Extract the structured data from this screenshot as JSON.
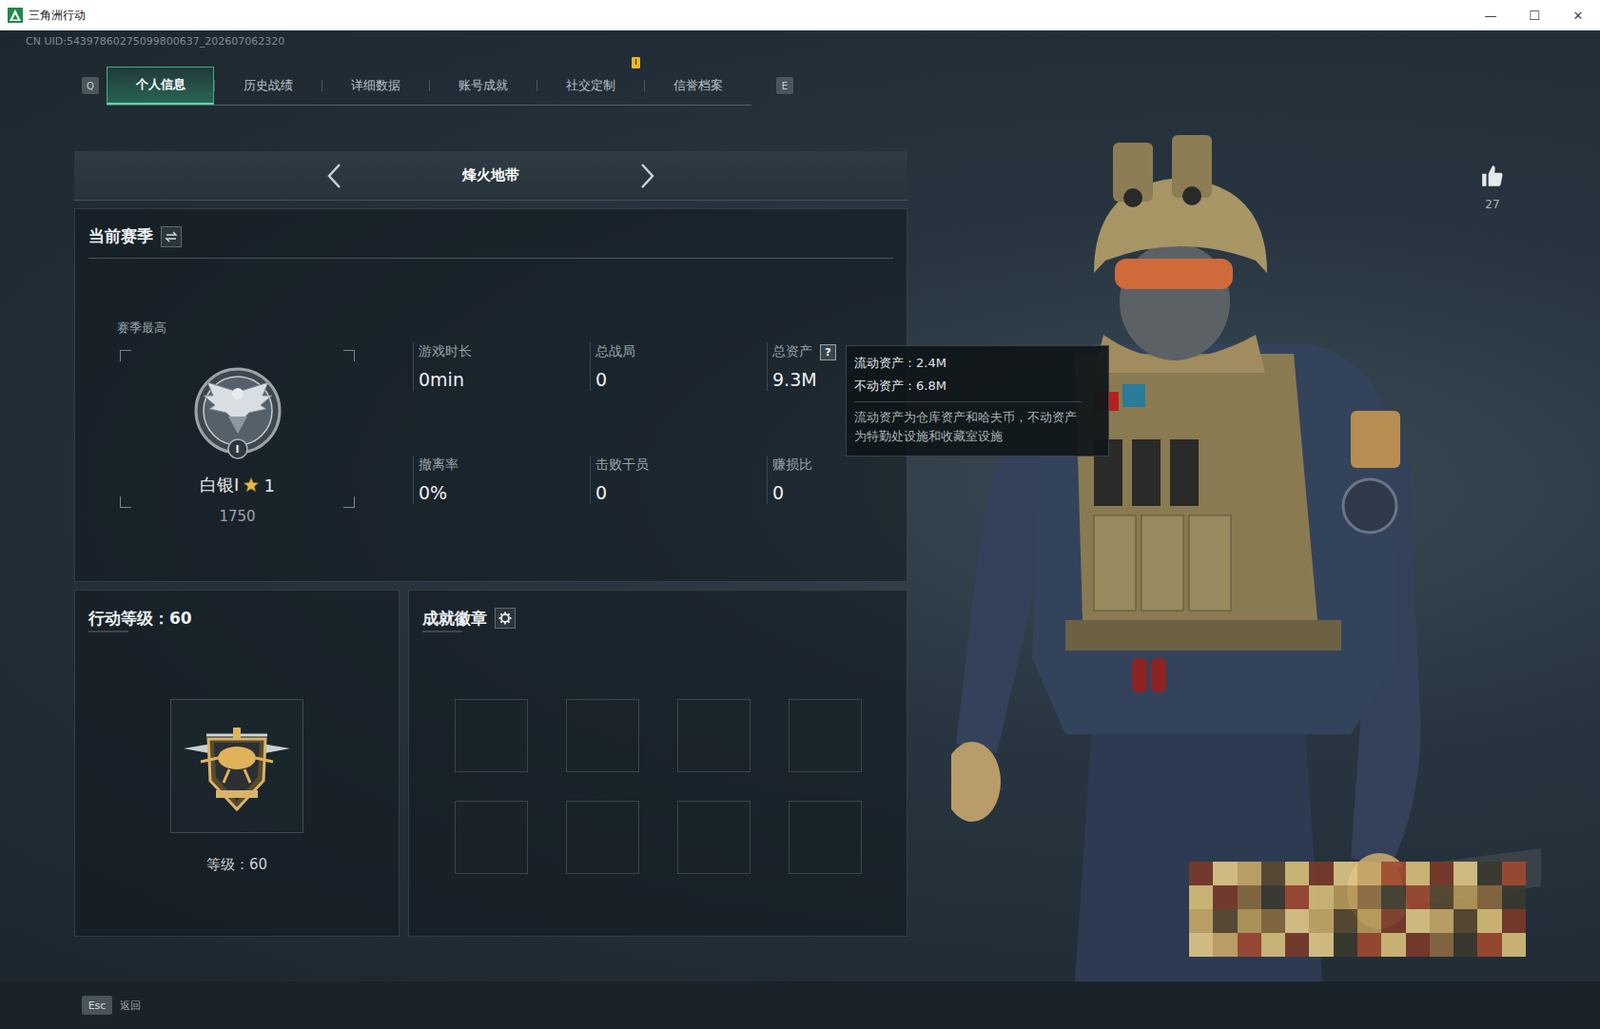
{
  "window": {
    "title": "三角洲行动",
    "controls": [
      "—",
      "☐",
      "✕"
    ]
  },
  "uid": "CN UID:54397860275099800637_202607062320",
  "tabs": {
    "prev_key": "Q",
    "next_key": "E",
    "items": [
      {
        "label": "个人信息",
        "selected": true,
        "notification": false
      },
      {
        "label": "历史战绩",
        "selected": false,
        "notification": false
      },
      {
        "label": "详细数据",
        "selected": false,
        "notification": false
      },
      {
        "label": "账号成就",
        "selected": false,
        "notification": false
      },
      {
        "label": "社交定制",
        "selected": false,
        "notification": true
      },
      {
        "label": "信誉档案",
        "selected": false,
        "notification": false
      }
    ]
  },
  "mode": {
    "label": "烽火地带"
  },
  "season": {
    "title": "当前赛季",
    "best_label": "赛季最高",
    "emblem_numeral": "I",
    "rank": "白银I",
    "stars": "1",
    "score": "1750",
    "stats": [
      {
        "label": "游戏时长",
        "value": "0min"
      },
      {
        "label": "总战局",
        "value": "0"
      },
      {
        "label": "总资产",
        "value": "9.3M",
        "help": "?"
      },
      {
        "label": "撤离率",
        "value": "0%"
      },
      {
        "label": "击败干员",
        "value": "0"
      },
      {
        "label": "赚损比",
        "value": "0"
      }
    ]
  },
  "tooltip": {
    "lines": [
      "流动资产：2.4M",
      "不动资产：6.8M"
    ],
    "note": "流动资产为仓库资产和哈夫币，不动资产为特勤处设施和收藏室设施"
  },
  "level": {
    "title": "行动等级：60",
    "caption": "等级：60"
  },
  "badges": {
    "title": "成就徽章",
    "slots": [
      {
        "empty": true
      },
      {
        "empty": true
      },
      {
        "empty": true
      },
      {
        "empty": true
      },
      {
        "empty": true
      },
      {
        "empty": true
      },
      {
        "empty": true
      },
      {
        "empty": true
      }
    ]
  },
  "likes": {
    "count": "27"
  },
  "footer": {
    "key": "Esc",
    "label": "返回"
  }
}
